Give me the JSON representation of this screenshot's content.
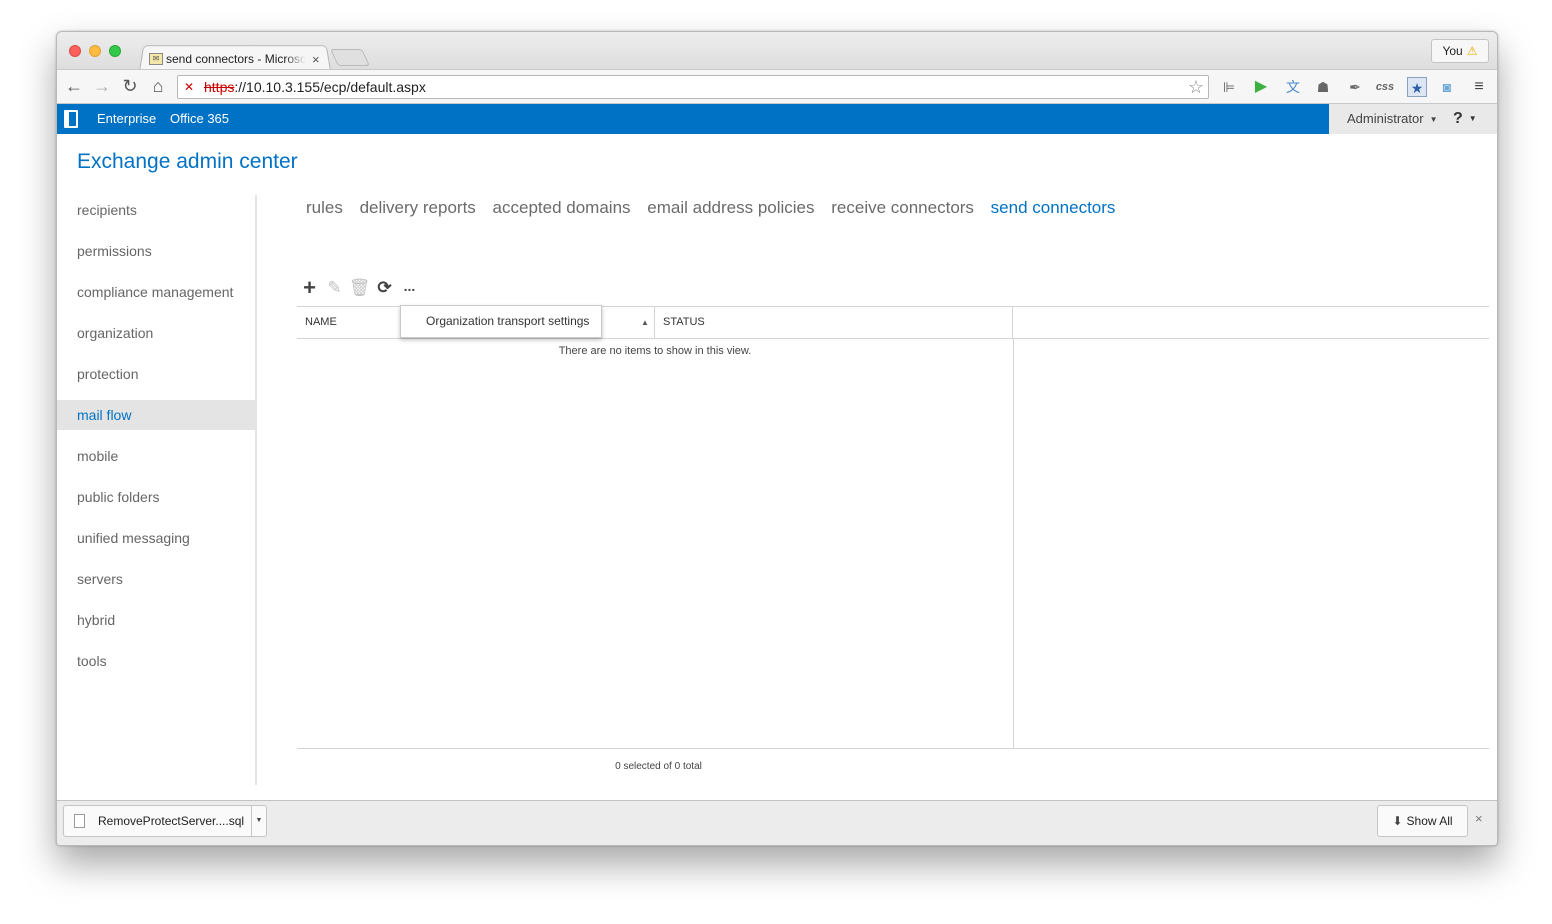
{
  "browser": {
    "tab_title": "send connectors - Microso",
    "tab_close": "×",
    "profile_label": "You",
    "url_scheme": "https",
    "url_rest": "://10.10.3.155/ecp/default.aspx",
    "ext_css_label": "css"
  },
  "o365": {
    "links": [
      "Enterprise",
      "Office 365"
    ],
    "user": "Administrator",
    "help": "?"
  },
  "app": {
    "title": "Exchange admin center"
  },
  "sidebar": {
    "items": [
      {
        "label": "recipients"
      },
      {
        "label": "permissions"
      },
      {
        "label": "compliance management"
      },
      {
        "label": "organization"
      },
      {
        "label": "protection"
      },
      {
        "label": "mail flow",
        "active": true
      },
      {
        "label": "mobile"
      },
      {
        "label": "public folders"
      },
      {
        "label": "unified messaging"
      },
      {
        "label": "servers"
      },
      {
        "label": "hybrid"
      },
      {
        "label": "tools"
      }
    ]
  },
  "subnav": {
    "tabs": [
      "rules",
      "delivery reports",
      "accepted domains",
      "email address policies",
      "receive connectors",
      "send connectors"
    ],
    "active": "send connectors"
  },
  "toolbar": {
    "more_label": "...",
    "menu_item": "Organization transport settings"
  },
  "grid": {
    "columns": [
      "NAME",
      "STATUS"
    ],
    "empty_message": "There are no items to show in this view.",
    "count_text": "0 selected of 0 total"
  },
  "downloads": {
    "file_name": "RemoveProtectServer....sql",
    "show_all_label": "Show All",
    "close": "×"
  },
  "colors": {
    "accent": "#0072c6",
    "nav_active_bg": "#e4e4e4",
    "text_muted": "#6b6b6b"
  }
}
